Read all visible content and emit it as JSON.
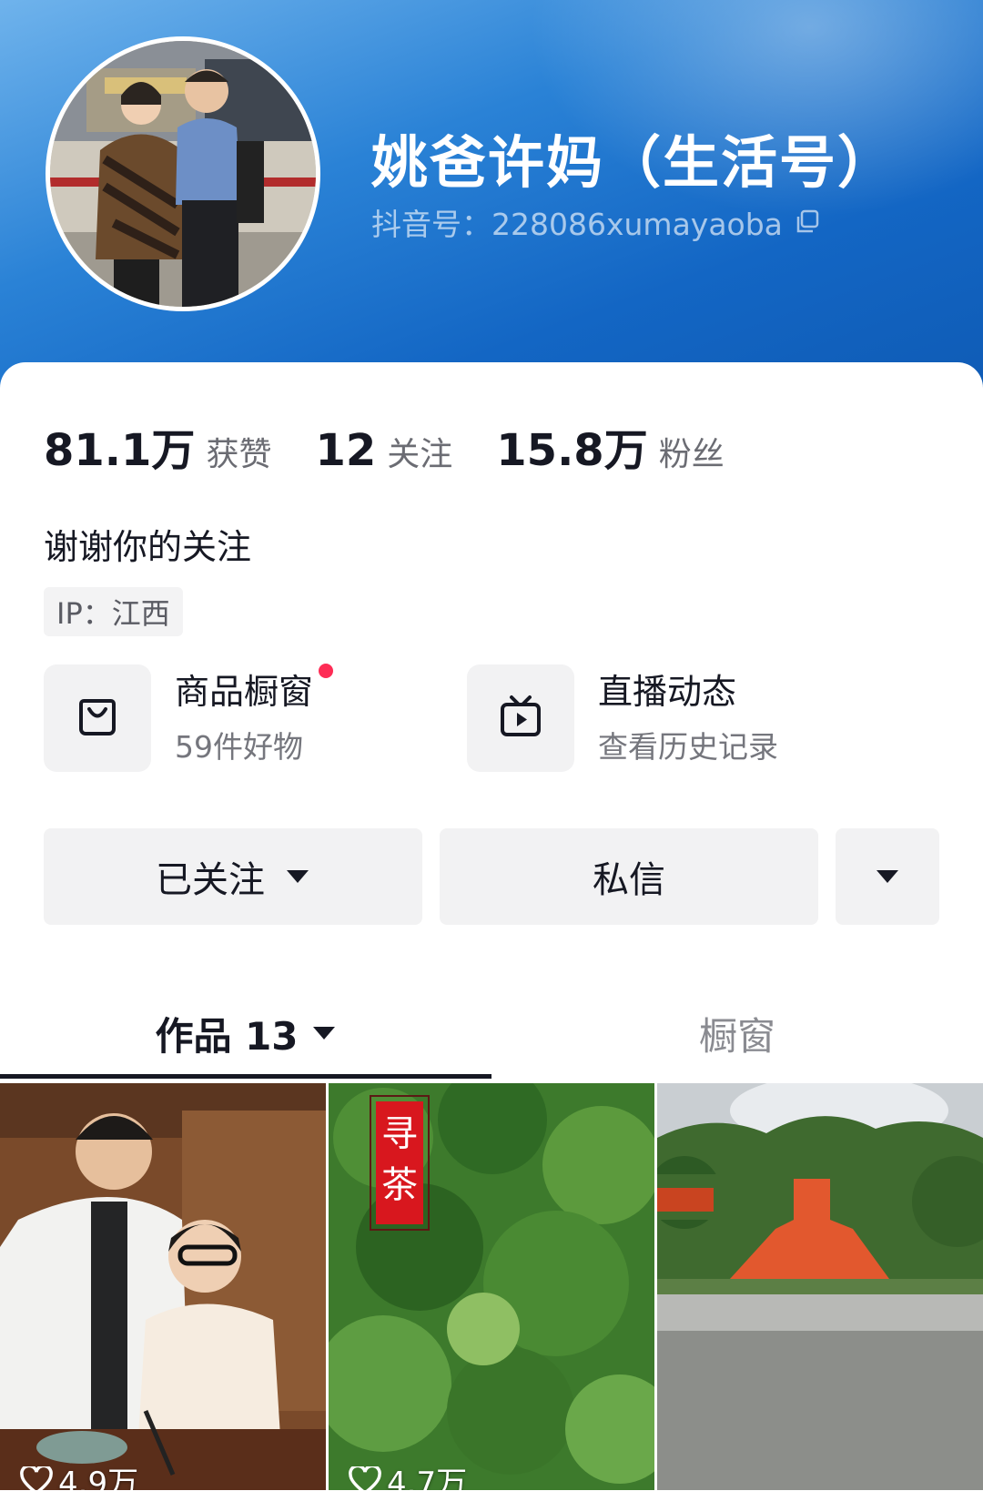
{
  "profile": {
    "nickname": "姚爸许妈（生活号）",
    "douyin_id": "抖音号：228086xumayaoba",
    "copy_icon": "copy-icon",
    "bio": "谢谢你的关注",
    "ip": "IP：江西"
  },
  "stats": [
    {
      "value": "81.1万",
      "label": "获赞"
    },
    {
      "value": "12",
      "label": "关注"
    },
    {
      "value": "15.8万",
      "label": "粉丝"
    }
  ],
  "features": [
    {
      "title": "商品橱窗",
      "subtitle": "59件好物",
      "icon": "shopping-bag-icon",
      "has_badge": true
    },
    {
      "title": "直播动态",
      "subtitle": "查看历史记录",
      "icon": "tv-play-icon"
    }
  ],
  "actions": {
    "follow_label": "已关注",
    "message_label": "私信"
  },
  "tabs": [
    {
      "label": "作品 13",
      "active": true
    },
    {
      "label": "橱窗",
      "active": false
    }
  ],
  "videos": [
    {
      "likes": "4.9万"
    },
    {
      "likes": "4.7万",
      "overlay_text": "寻茶"
    },
    {
      "likes": ""
    }
  ],
  "colors": {
    "header_blue": "#1366c4",
    "accent_red": "#fe2c55",
    "text_primary": "#161823",
    "text_secondary": "#75767d"
  }
}
